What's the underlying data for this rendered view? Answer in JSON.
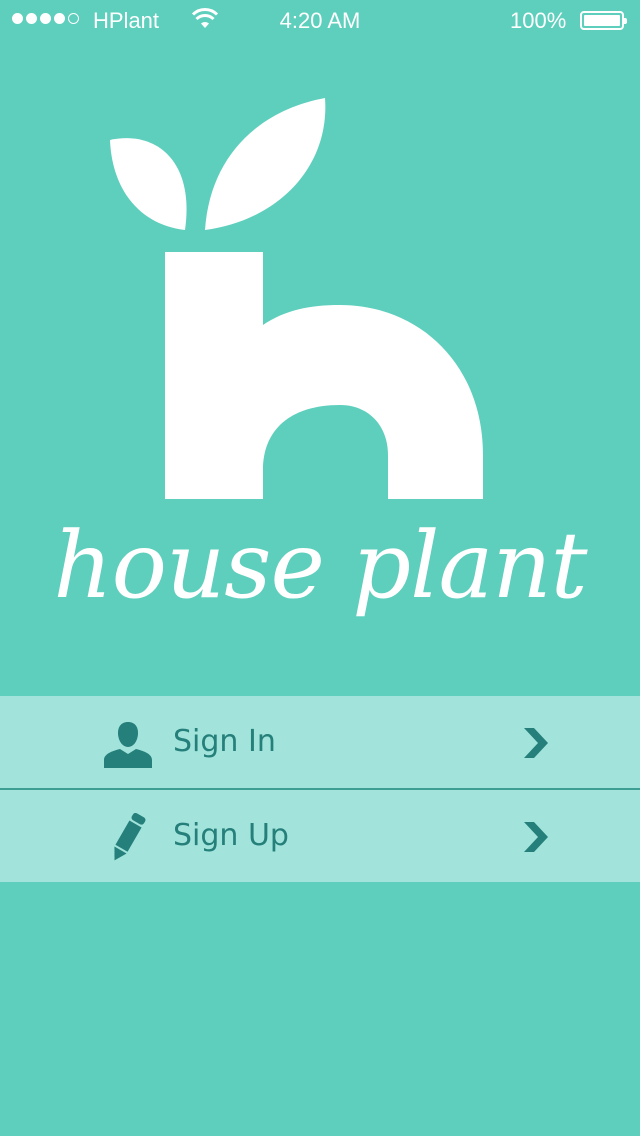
{
  "status_bar": {
    "carrier": "HPlant",
    "time": "4:20 AM",
    "battery_percent": "100%",
    "signal_bars_filled": 4,
    "signal_bars_total": 5,
    "wifi_icon": "wifi-icon",
    "battery_icon": "battery-icon"
  },
  "brand": {
    "wordmark": "house plant",
    "logo_icon": "house-plant-h-leaf-logo"
  },
  "menu": {
    "items": [
      {
        "label": "Sign In",
        "icon": "user-icon",
        "action_icon": "chevron-right-icon"
      },
      {
        "label": "Sign Up",
        "icon": "pencil-icon",
        "action_icon": "chevron-right-icon"
      }
    ]
  },
  "colors": {
    "background": "#5ecfbd",
    "menu_row": "#a2e4db",
    "menu_text": "#257f7a",
    "foreground": "#ffffff"
  }
}
